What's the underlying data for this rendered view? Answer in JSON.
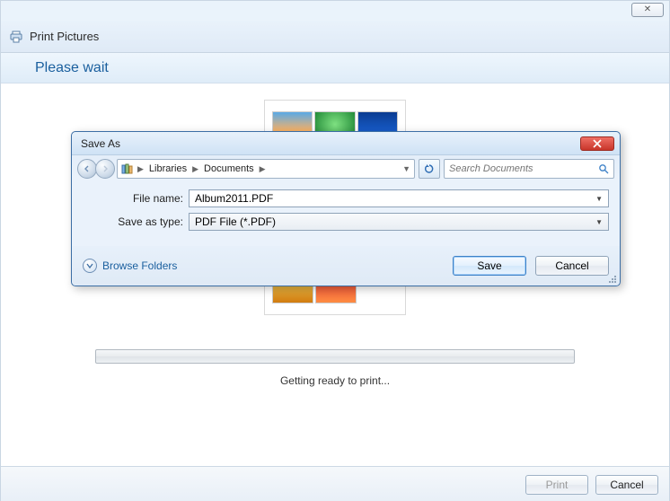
{
  "outer": {
    "title": "Print Pictures",
    "banner": "Please wait",
    "status": "Getting ready to print...",
    "close_symbol": "✕",
    "buttons": {
      "print": "Print",
      "cancel": "Cancel"
    }
  },
  "saveas": {
    "title": "Save As",
    "breadcrumb": {
      "seg1": "Libraries",
      "seg2": "Documents"
    },
    "search_placeholder": "Search Documents",
    "labels": {
      "filename": "File name:",
      "filetype": "Save as type:"
    },
    "values": {
      "filename": "Album2011.PDF",
      "filetype": "PDF File (*.PDF)"
    },
    "browse": "Browse Folders",
    "buttons": {
      "save": "Save",
      "cancel": "Cancel"
    }
  }
}
